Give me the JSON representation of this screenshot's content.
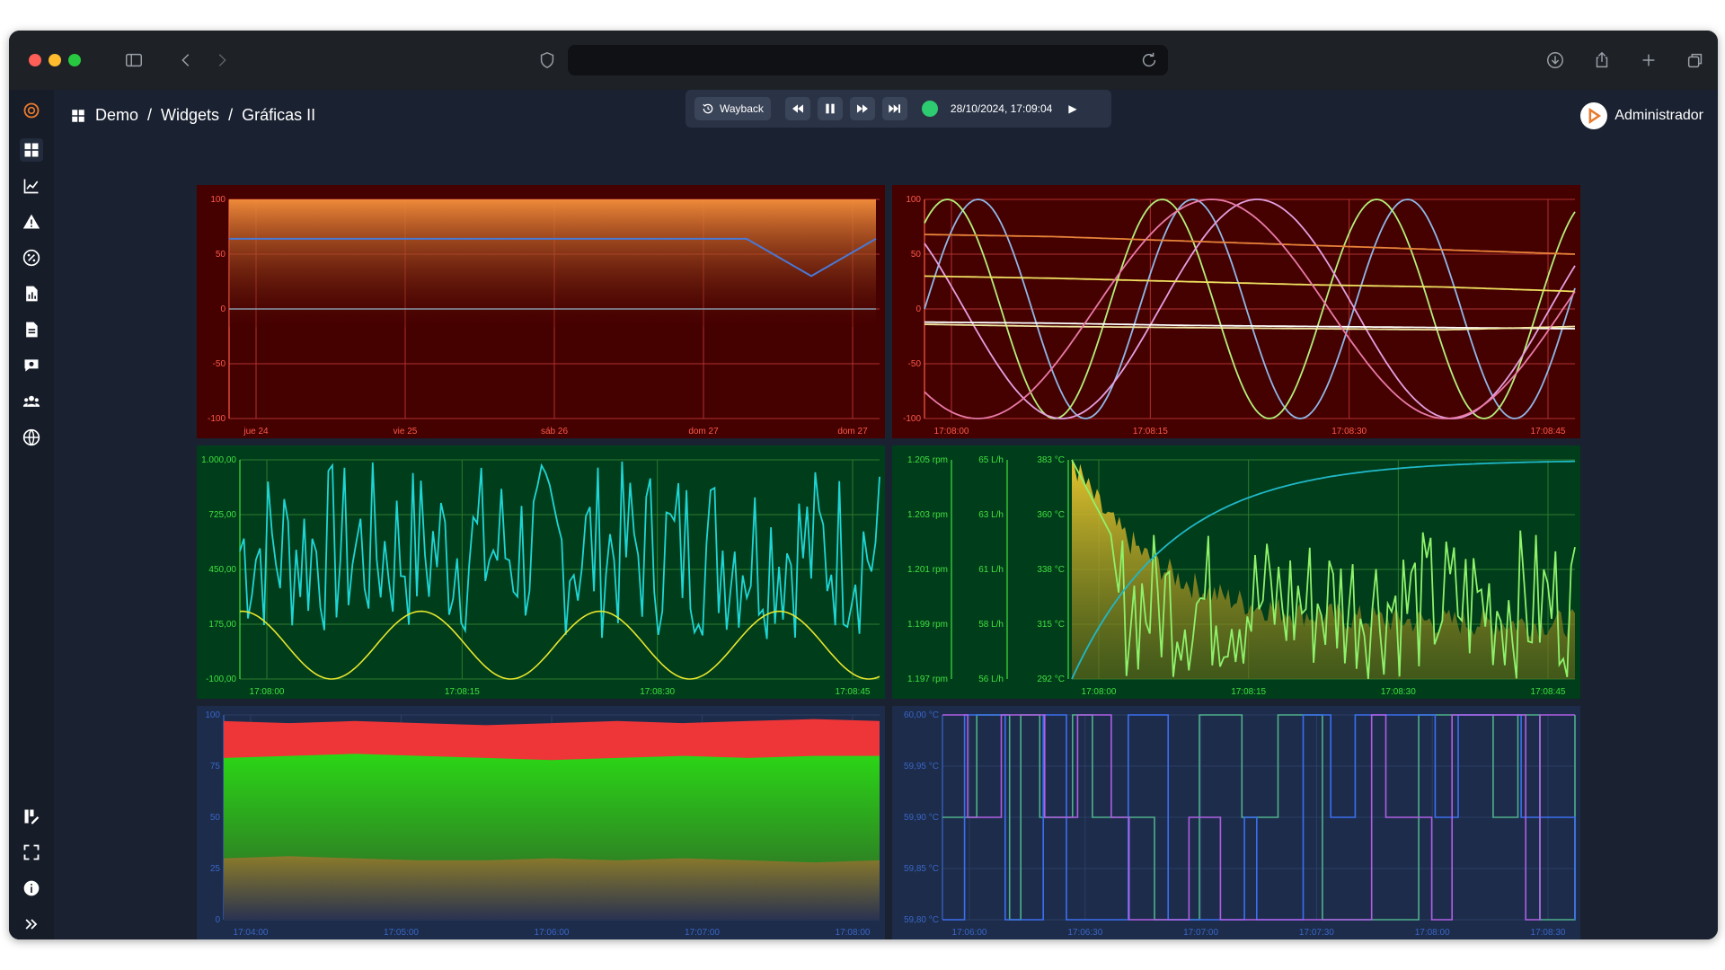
{
  "breadcrumb": {
    "home": "Demo",
    "section": "Widgets",
    "page": "Gráficas II"
  },
  "player": {
    "wayback_label": "Wayback",
    "datetime": "28/10/2024, 17:09:04"
  },
  "user": {
    "name": "Administrador"
  },
  "sidebar": {
    "items": [
      "dashboard-icon",
      "chart-line-icon",
      "alert-icon",
      "percent-icon",
      "report-icon",
      "document-icon",
      "chat-icon",
      "users-icon",
      "globe-icon"
    ],
    "bottom": [
      "edit-icon",
      "fullscreen-icon",
      "info-icon",
      "expand-icon"
    ]
  },
  "colors": {
    "red_panel": "#450000",
    "green_panel": "#003d1a",
    "blue_panel": "#1c2c4a",
    "orange": "#e87a2e",
    "cyan": "#1fd6d6",
    "yellow": "#e6e62e",
    "green_line": "#8ef26a",
    "red_fill": "#ee3538",
    "green_fill": "#2bd616",
    "olive_fill": "#8a7a2a",
    "purple": "#b15ee6",
    "blue": "#3c6ff0",
    "teal": "#4fb08c"
  },
  "chart_data": [
    {
      "type": "area",
      "ylim": [
        -100,
        100
      ],
      "yticks": [
        "100",
        "50",
        "0",
        "-50",
        "-100"
      ],
      "xticks": [
        "jue 24",
        "vie 25",
        "sáb 26",
        "dom 27",
        "dom 27"
      ],
      "series": [
        {
          "values": [
            64,
            64,
            64,
            64,
            64,
            64,
            64,
            64,
            64,
            30,
            64
          ]
        },
        {
          "values": [
            0,
            0,
            0,
            0,
            0,
            0,
            0,
            0,
            0,
            0,
            0
          ]
        }
      ]
    },
    {
      "type": "line",
      "ylim": [
        -100,
        100
      ],
      "yticks": [
        "100",
        "50",
        "0",
        "-50",
        "-100"
      ],
      "xticks": [
        "17:08:00",
        "17:08:15",
        "17:08:30",
        "17:08:45"
      ],
      "series": [
        {
          "kind": "sine",
          "period": 0.33,
          "phase": 0.0,
          "amp": 100
        },
        {
          "kind": "sine",
          "period": 0.33,
          "phase": 0.9,
          "amp": 100
        },
        {
          "kind": "sine",
          "period": 0.6,
          "phase": 2.5,
          "amp": 100
        },
        {
          "kind": "trend",
          "values": [
            68,
            66,
            62,
            58,
            54,
            50
          ]
        },
        {
          "kind": "trend",
          "values": [
            30,
            28,
            25,
            22,
            20,
            16
          ]
        },
        {
          "kind": "trend",
          "values": [
            -12,
            -13,
            -15,
            -16,
            -17,
            -18
          ]
        },
        {
          "kind": "trend",
          "values": [
            -14,
            -16,
            -17,
            -18,
            -19,
            -16
          ]
        },
        {
          "kind": "sine",
          "period": 0.72,
          "phase": 4.0,
          "amp": 100
        }
      ]
    },
    {
      "type": "line",
      "ylim": [
        -100,
        1000
      ],
      "yticks": [
        "1.000,00",
        "725,00",
        "450,00",
        "175,00",
        "-100,00"
      ],
      "xticks": [
        "17:08:00",
        "17:08:15",
        "17:08:30",
        "17:08:45"
      ],
      "series": [
        {
          "kind": "noise",
          "min": 100,
          "max": 1000,
          "points": 160
        },
        {
          "kind": "sine",
          "period": 0.28,
          "phase": 1.5,
          "center": 70,
          "amp": 170
        }
      ]
    },
    {
      "type": "line",
      "y_axes": [
        {
          "ticks": [
            "1.205 rpm",
            "1.203 rpm",
            "1.201 rpm",
            "1.199 rpm",
            "1.197 rpm"
          ]
        },
        {
          "ticks": [
            "65 L/h",
            "63 L/h",
            "61 L/h",
            "58 L/h",
            "56 L/h"
          ]
        },
        {
          "ticks": [
            "383 °C",
            "360 °C",
            "338 °C",
            "315 °C",
            "292 °C"
          ]
        }
      ],
      "xticks": [
        "17:08:00",
        "17:08:15",
        "17:08:30",
        "17:08:45"
      ],
      "series": [
        {
          "kind": "saturating",
          "start": 292,
          "end": 383
        },
        {
          "kind": "noise",
          "min": 292,
          "max": 355,
          "points": 130
        },
        {
          "kind": "decay",
          "start": 383,
          "end": 315
        }
      ]
    },
    {
      "type": "area",
      "ylim": [
        0,
        100
      ],
      "yticks": [
        "100",
        "75",
        "50",
        "25",
        "0"
      ],
      "xticks": [
        "17:04:00",
        "17:05:00",
        "17:06:00",
        "17:07:00",
        "17:08:00"
      ],
      "series": [
        {
          "values": [
            97,
            96,
            97,
            96,
            95,
            96,
            97,
            96,
            97,
            98,
            97
          ]
        },
        {
          "values": [
            79,
            80,
            81,
            80,
            79,
            78,
            79,
            80,
            79,
            80,
            80
          ]
        },
        {
          "values": [
            30,
            31,
            30,
            29,
            29,
            30,
            29,
            30,
            29,
            28,
            29
          ]
        }
      ]
    },
    {
      "type": "line",
      "ylim": [
        59.8,
        60.0
      ],
      "yticks": [
        "60,00 °C",
        "59,95 °C",
        "59,90 °C",
        "59,85 °C",
        "59,80 °C"
      ],
      "xticks": [
        "17:06:00",
        "17:06:30",
        "17:07:00",
        "17:07:30",
        "17:08:00",
        "17:08:30"
      ],
      "series": [
        {
          "kind": "step"
        },
        {
          "kind": "step"
        },
        {
          "kind": "step"
        }
      ]
    }
  ]
}
